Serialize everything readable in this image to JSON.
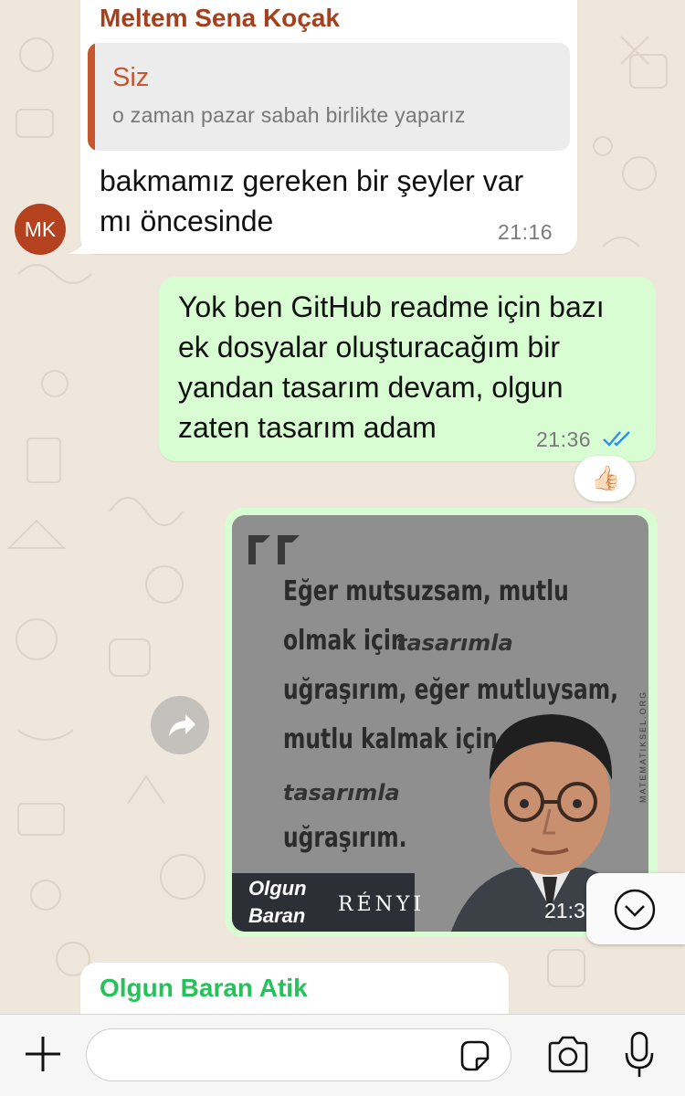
{
  "messages": [
    {
      "sender": "Meltem Sena Koçak",
      "avatar_initials": "MK",
      "reply_to": {
        "author": "Siz",
        "text": "o zaman pazar sabah birlikte yaparız"
      },
      "text_lines": [
        "bakmamız gereken bir şeyler var",
        "mı öncesinde"
      ],
      "time": "21:16"
    },
    {
      "text_lines": [
        "Yok ben GitHub readme için bazı",
        "ek dosyalar oluşturacağım bir",
        "yandan tasarım devam, olgun",
        "zaten tasarım adam"
      ],
      "time": "21:36",
      "reaction": "👍🏻"
    },
    {
      "image": {
        "quote_lines": [
          "Eğer mutsuzsam, mutlu",
          "olmak için",
          "uğraşırım, eğer mutluysam,",
          "mutlu kalmak için",
          "uğraşırım."
        ],
        "italic_words": [
          "tasarımla",
          "tasarımla"
        ],
        "watermark": "MATEMATIKSEL.ORG",
        "author_overlay": [
          "Olgun",
          "Baran"
        ],
        "author_name": "RÉNYI"
      },
      "time": "21:3"
    },
    {
      "sender": "Olgun Baran Atik"
    }
  ],
  "colors": {
    "chat_background": "#efe7dc",
    "incoming_bubble": "#ffffff",
    "outgoing_bubble": "#d9fdd3",
    "sender_meltem": "#a3401d",
    "sender_olgun": "#25c15a",
    "reply_accent": "#c5562e",
    "read_ticks": "#2a8ff7"
  },
  "composer": {
    "placeholder": ""
  },
  "icons": [
    "plus-icon",
    "sticker-icon",
    "camera-icon",
    "microphone-icon",
    "forward-icon",
    "chevron-down-icon",
    "read-receipt-icon"
  ]
}
